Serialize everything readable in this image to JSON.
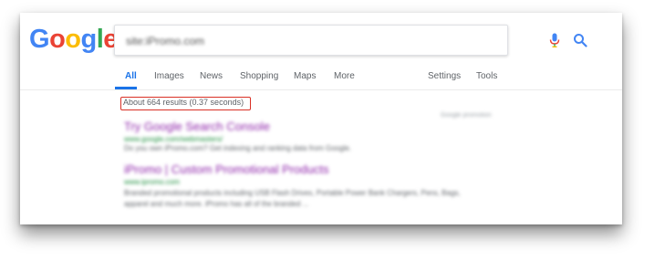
{
  "logo": {
    "letters": [
      "G",
      "o",
      "o",
      "g",
      "l",
      "e"
    ],
    "colors": [
      "#4285f4",
      "#ea4335",
      "#fbbc05",
      "#4285f4",
      "#34a853",
      "#ea4335"
    ]
  },
  "search": {
    "query": "site:iPromo.com"
  },
  "tabs": {
    "all": "All",
    "images": "Images",
    "news": "News",
    "shopping": "Shopping",
    "maps": "Maps",
    "more": "More",
    "settings": "Settings",
    "tools": "Tools"
  },
  "result_stats": "About 664 results (0.37 seconds)",
  "ad_label": "Google promotion",
  "results": [
    {
      "title": "Try Google Search Console",
      "url": "www.google.com/webmasters/",
      "snippet": "Do you own iPromo.com? Get indexing and ranking data from Google."
    },
    {
      "title": "iPromo | Custom Promotional Products",
      "url": "www.ipromo.com",
      "snippet": "Branded promotional products including USB Flash Drives, Portable Power Bank Chargers, Pens, Bags,",
      "snippet2": "apparel and much more. iPromo has all of the branded ..."
    }
  ],
  "colors": {
    "accent": "#1a73e8",
    "highlight_box": "#d93025",
    "visited_link": "#8e24aa",
    "url_green": "#1e8e3e"
  }
}
